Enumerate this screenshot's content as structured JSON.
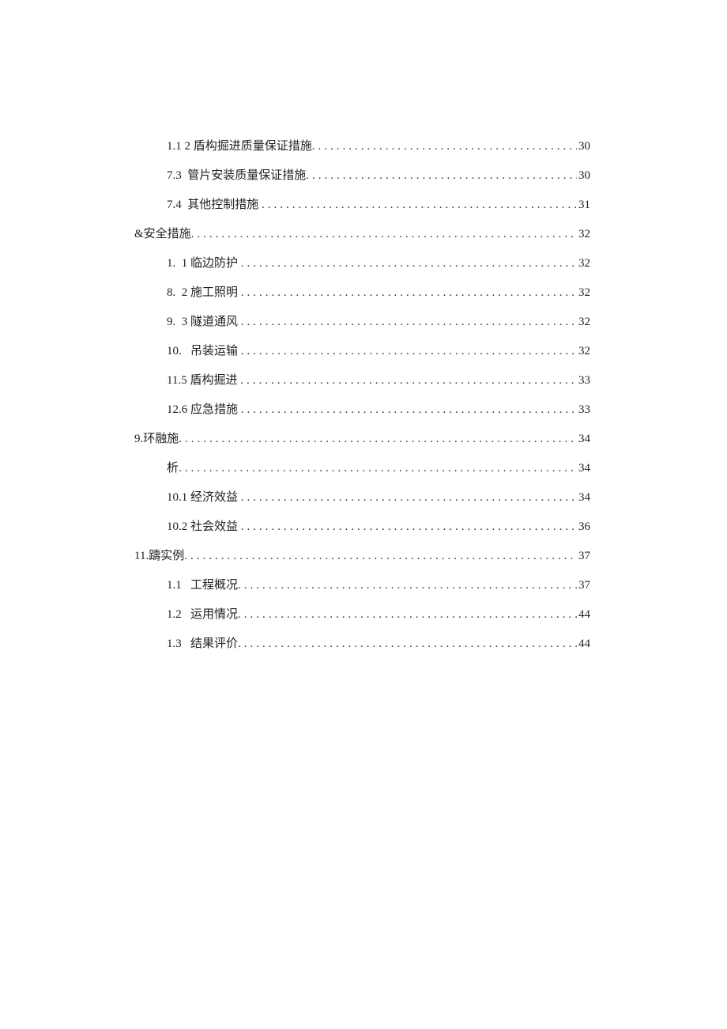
{
  "toc": [
    {
      "level": 2,
      "label": "1.1 2 盾构掘进质量保证措施",
      "page": "30"
    },
    {
      "level": 2,
      "label": "7.3  管片安装质量保证措施",
      "page": "30"
    },
    {
      "level": 2,
      "label": "7.4  其他控制措施 ",
      "page": "31"
    },
    {
      "level": 1,
      "label": "&安全措施",
      "page": "32"
    },
    {
      "level": 2,
      "label": "1.  1 临边防护 ",
      "page": "32"
    },
    {
      "level": 2,
      "label": "8.  2 施工照明 ",
      "page": "32"
    },
    {
      "level": 2,
      "label": "9.  3 隧道通风 ",
      "page": "32"
    },
    {
      "level": 2,
      "label": "10.   吊装运输 ",
      "page": "32"
    },
    {
      "level": 2,
      "label": "11.5 盾构掘进 ",
      "page": "33"
    },
    {
      "level": 2,
      "label": "12.6 应急措施 ",
      "page": "33"
    },
    {
      "level": 1,
      "label": "9.环融施",
      "page": "34"
    },
    {
      "level": 2,
      "label": "析",
      "page": "34"
    },
    {
      "level": 2,
      "label": "10.1 经济效益 ",
      "page": "34"
    },
    {
      "level": 2,
      "label": "10.2 社会效益 ",
      "page": "36"
    },
    {
      "level": 1,
      "label": "11.躊实例",
      "page": "37"
    },
    {
      "level": 2,
      "label": "1.1   工程概况",
      "page": "37"
    },
    {
      "level": 2,
      "label": "1.2   运用情况",
      "page": "44"
    },
    {
      "level": 2,
      "label": "1.3   结果评价",
      "page": "44"
    }
  ]
}
